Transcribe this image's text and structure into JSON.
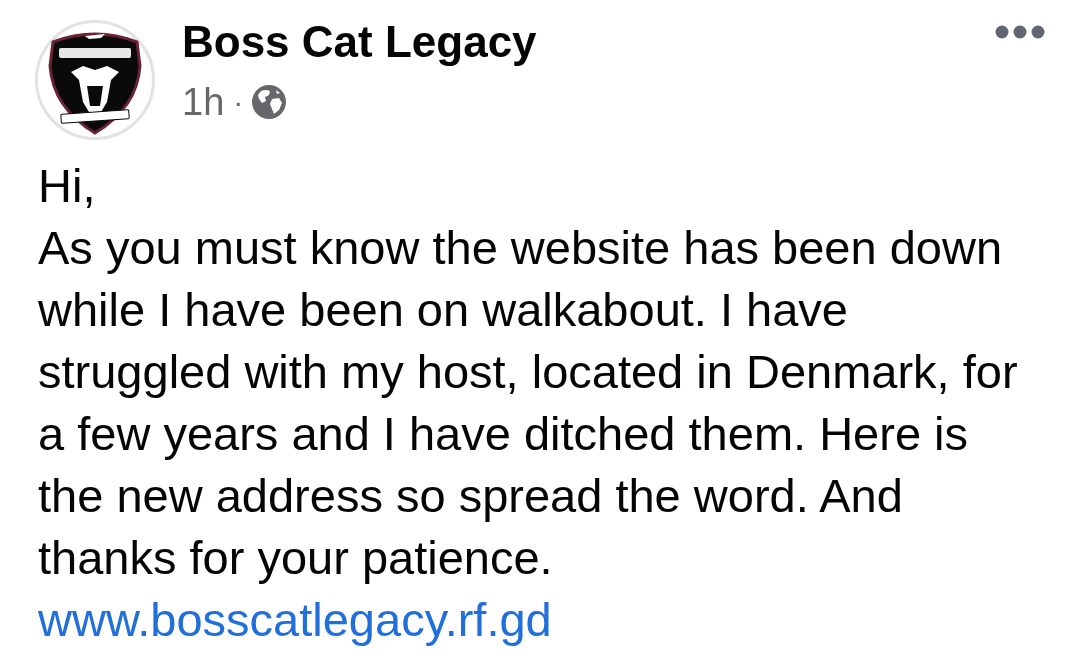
{
  "post": {
    "author": "Boss Cat Legacy",
    "time": "1h",
    "separator": "·",
    "paragraphs": [
      "Hi,",
      "As you must know the website has been down while I have been on walkabout. I have struggled with my host, located in Denmark, for a few years and I have ditched them. Here is the new address so spread the word. And thanks for your patience."
    ],
    "link": "www.bosscatlegacy.rf.gd"
  }
}
